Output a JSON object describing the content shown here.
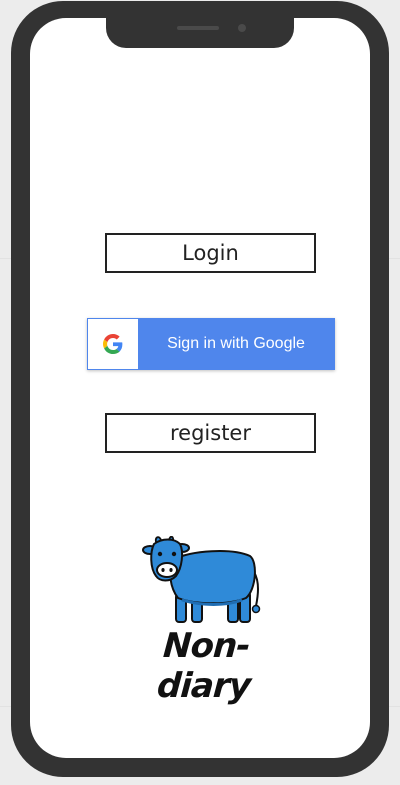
{
  "auth": {
    "login_label": "Login",
    "google_label": "Sign in with Google",
    "register_label": "register"
  },
  "brand": {
    "name": "Non-diary"
  },
  "colors": {
    "phone_frame": "#333333",
    "google_blue": "#4f86ec",
    "cow_blue": "#2f8ad8"
  }
}
